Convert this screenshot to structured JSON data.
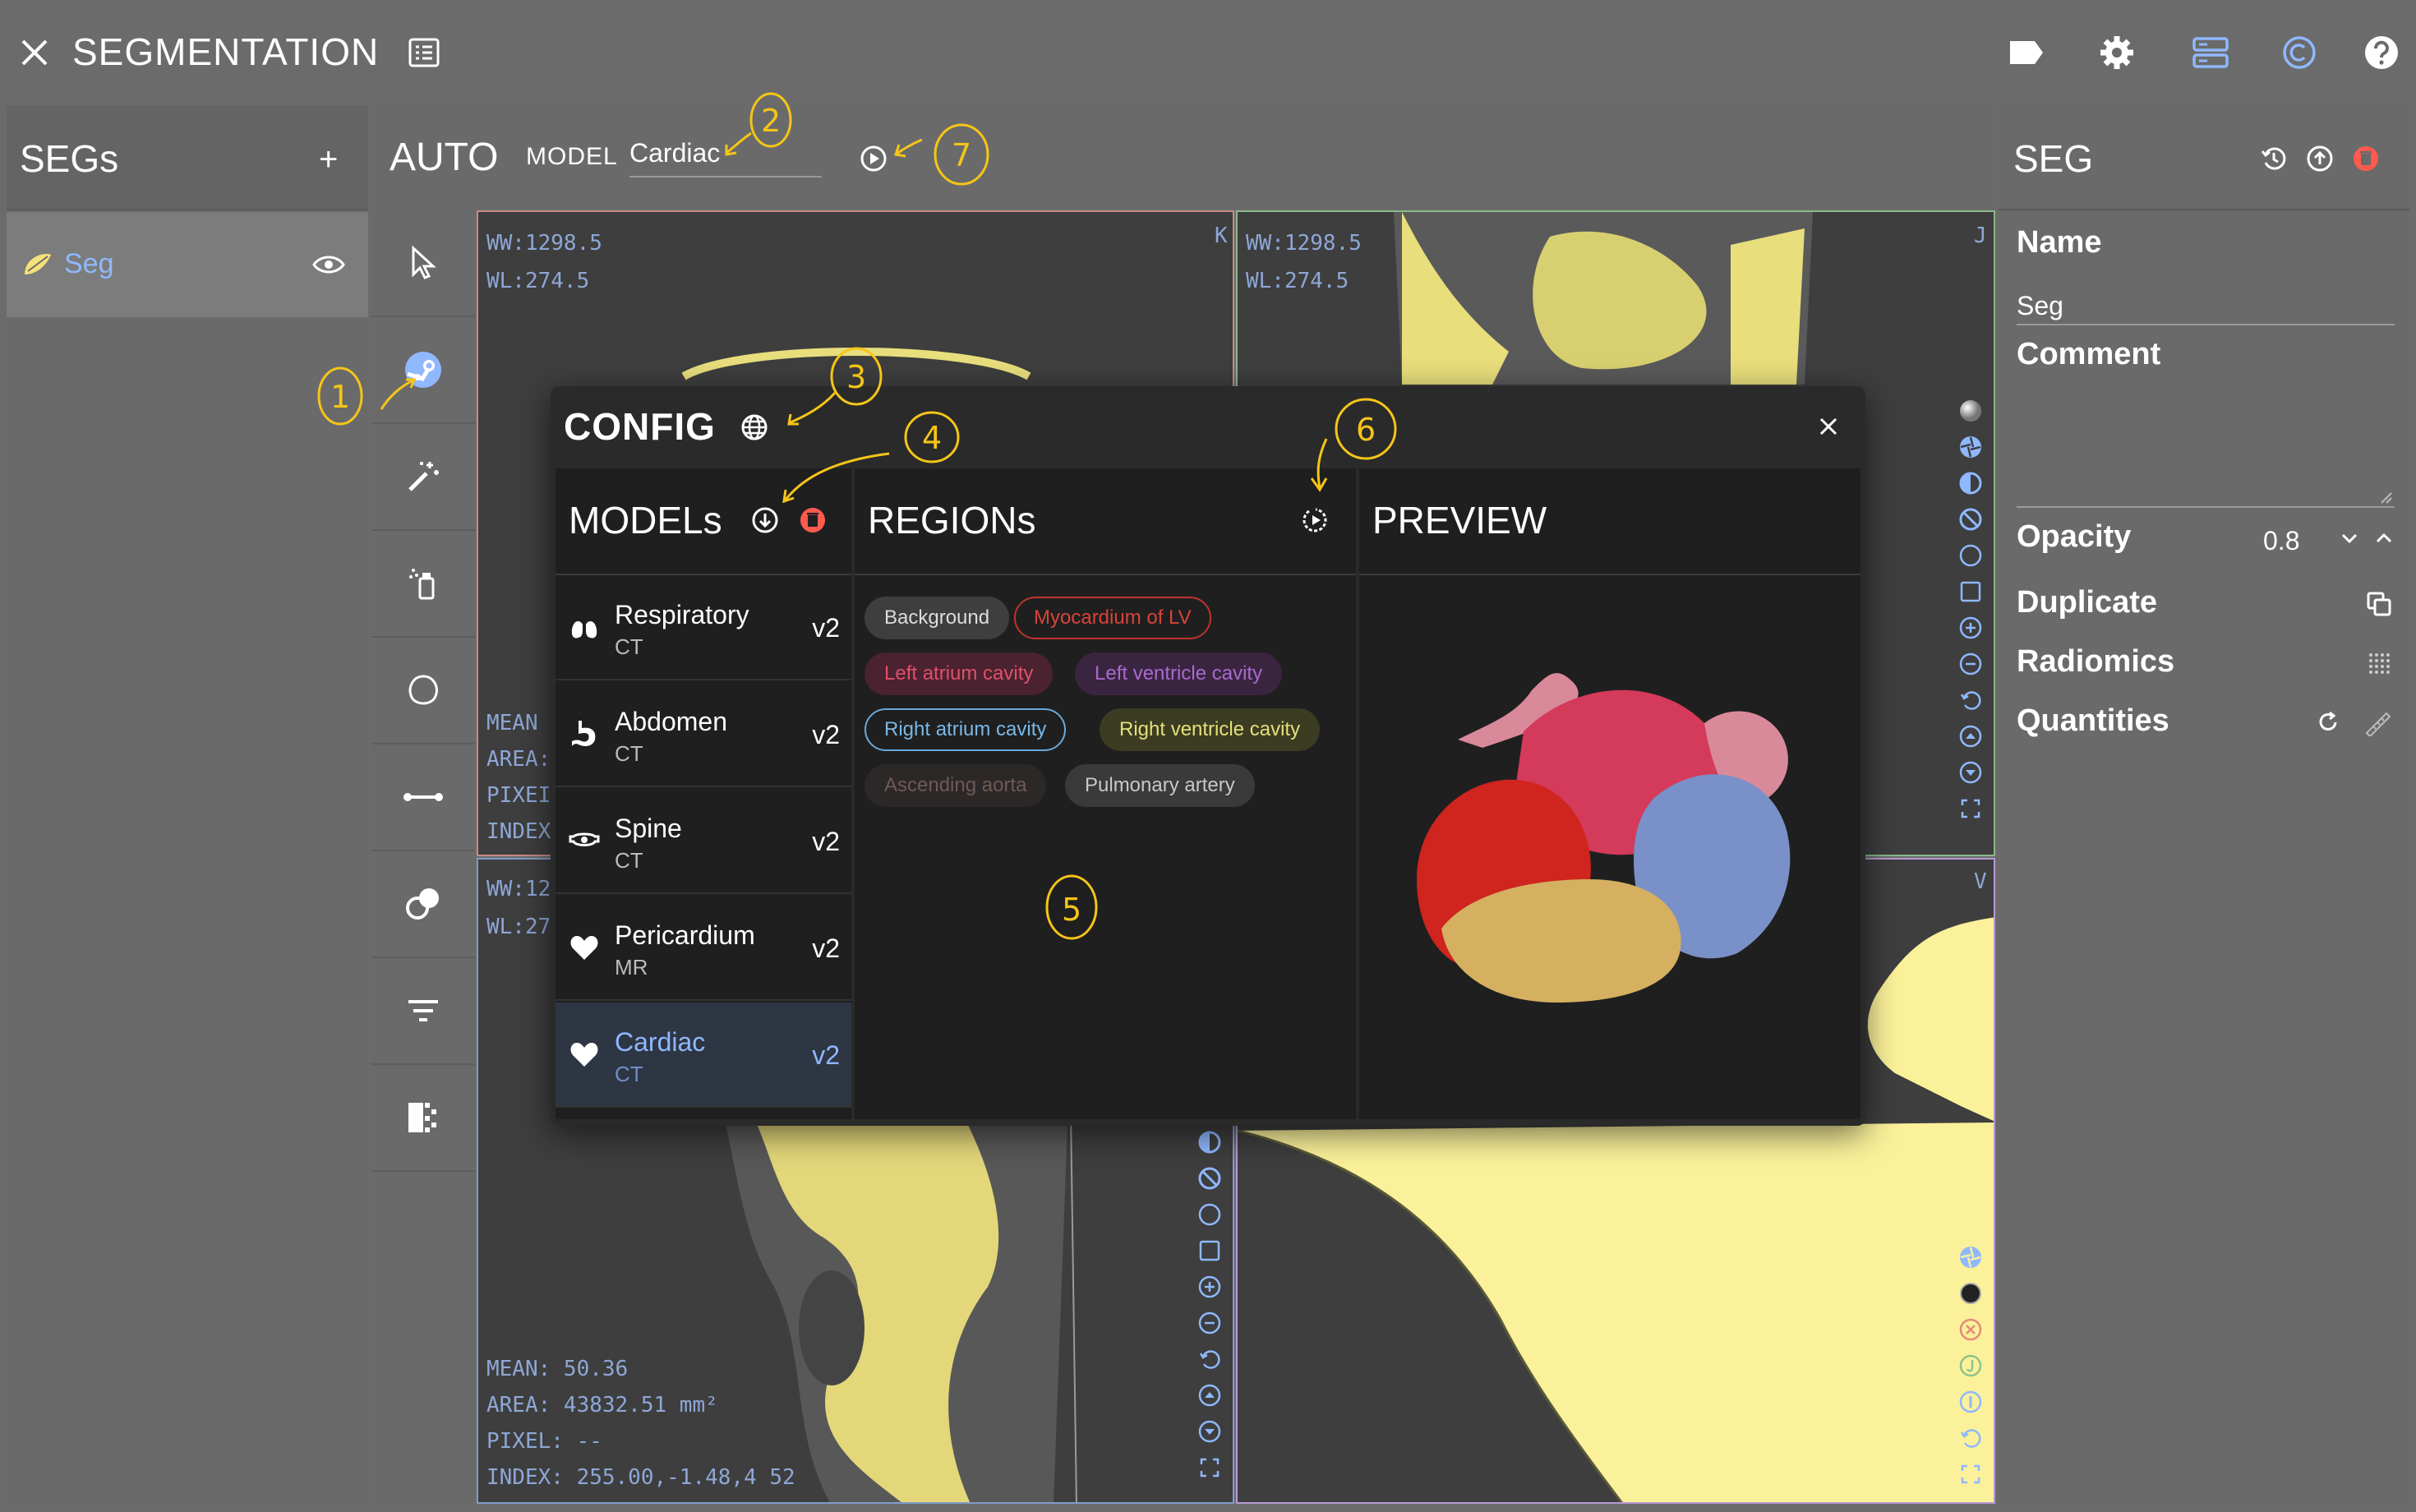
{
  "app": {
    "title": "SEGMENTATION"
  },
  "segs_panel": {
    "title": "SEGs",
    "add_label": "+",
    "items": [
      {
        "label": "Seg",
        "visible": true,
        "color": "#f5e17a"
      }
    ]
  },
  "auto": {
    "title": "AUTO",
    "model_label": "MODEL",
    "model_value": "Cardiac"
  },
  "viewports": {
    "axial": {
      "ww": "WW:1298.5",
      "wl": "WL:274.5",
      "orient": "K",
      "stats": [
        "MEAN",
        "AREA:",
        "PIXEI",
        "INDEX"
      ]
    },
    "coronal": {
      "ww": "WW:1298.5",
      "wl": "WL:274.5",
      "orient": "J"
    },
    "sagittal": {
      "ww": "WW:12",
      "wl": "WL:27",
      "mean": "MEAN: 50.36",
      "area": "AREA: 43832.51 mm²",
      "pixel": "PIXEL: --",
      "index": "INDEX: 255.00,-1.48,4 52"
    },
    "volume": {
      "orient": "V"
    }
  },
  "seg_panel": {
    "title": "SEG",
    "name_label": "Name",
    "name_value": "Seg",
    "comment_label": "Comment",
    "opacity_label": "Opacity",
    "opacity_value": "0.8",
    "duplicate_label": "Duplicate",
    "radiomics_label": "Radiomics",
    "quantities_label": "Quantities"
  },
  "config": {
    "title": "CONFIG",
    "models_title": "MODELs",
    "regions_title": "REGIONs",
    "preview_title": "PREVIEW",
    "models": [
      {
        "name": "Respiratory",
        "modality": "CT",
        "version": "v2",
        "icon": "lungs-icon",
        "selected": false
      },
      {
        "name": "Abdomen",
        "modality": "CT",
        "version": "v2",
        "icon": "stomach-icon",
        "selected": false
      },
      {
        "name": "Spine",
        "modality": "CT",
        "version": "v2",
        "icon": "vertebra-icon",
        "selected": false
      },
      {
        "name": "Pericardium",
        "modality": "MR",
        "version": "v2",
        "icon": "heart-icon",
        "selected": false
      },
      {
        "name": "Cardiac",
        "modality": "CT",
        "version": "v2",
        "icon": "heart-icon",
        "selected": true
      }
    ],
    "regions": [
      {
        "label": "Background",
        "style": "filled-gray"
      },
      {
        "label": "Myocardium of LV",
        "style": "outlined-red"
      },
      {
        "label": "Left atrium cavity",
        "style": "filled-pink"
      },
      {
        "label": "Left ventricle cavity",
        "style": "filled-purple"
      },
      {
        "label": "Right atrium cavity",
        "style": "outlined-blue"
      },
      {
        "label": "Right ventricle cavity",
        "style": "filled-yellow"
      },
      {
        "label": "Ascending aorta",
        "style": "filled-dim"
      },
      {
        "label": "Pulmonary artery",
        "style": "filled-gray"
      }
    ]
  },
  "annotations": [
    "1",
    "2",
    "3",
    "4",
    "5",
    "6",
    "7"
  ],
  "colors": {
    "accent": "#8fb8ff",
    "annotation": "#f5c518",
    "seg_yellow": "#f2ea8f",
    "danger": "#ff5a4e",
    "panel_bg": "#6a6a6a",
    "dialog_bg": "#1f1f1f"
  }
}
